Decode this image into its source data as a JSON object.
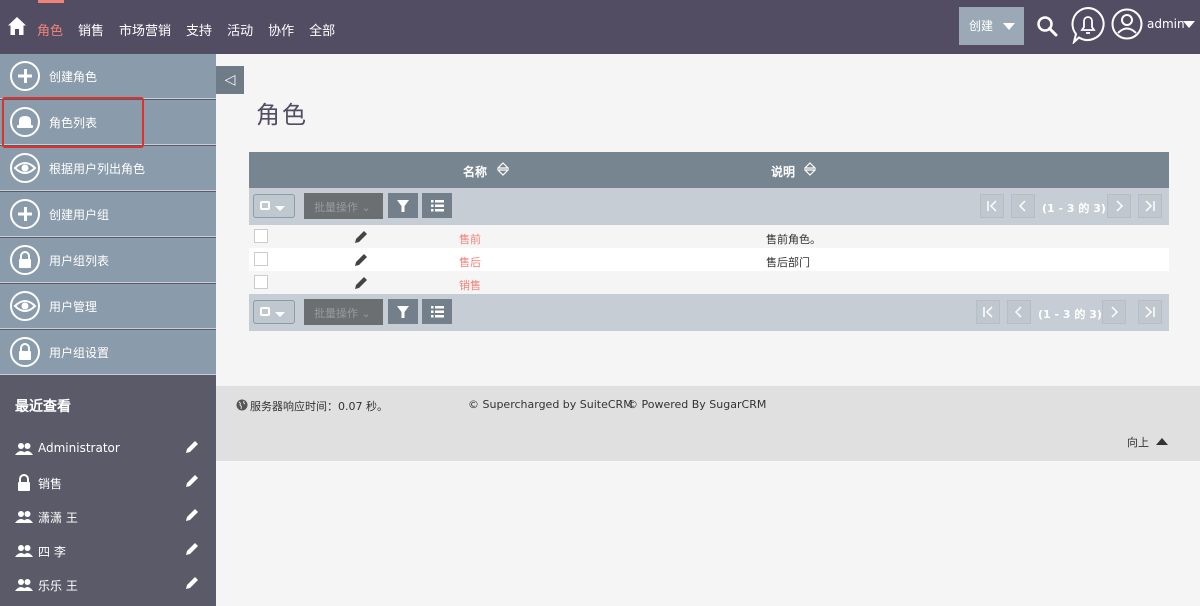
{
  "topnav": {
    "items": [
      "角色",
      "销售",
      "市场营销",
      "支持",
      "活动",
      "协作",
      "全部"
    ],
    "create_label": "创建",
    "user": "admin"
  },
  "sidebar": {
    "actions": [
      "创建角色",
      "角色列表",
      "根据用户列出角色",
      "创建用户组",
      "用户组列表",
      "用户管理",
      "用户组设置"
    ],
    "recent_title": "最近查看",
    "recent": [
      "Administrator",
      "销售",
      "潇潇 王",
      "四 李",
      "乐乐 王"
    ]
  },
  "main": {
    "title": "角色",
    "columns": [
      "名称",
      "说明"
    ],
    "bulk_label": "批量操作",
    "page_count": "(1 - 3 的 3)",
    "rows": [
      {
        "name": "售前",
        "desc": "售前角色。"
      },
      {
        "name": "售后",
        "desc": "售后部门"
      },
      {
        "name": "销售",
        "desc": ""
      }
    ]
  },
  "footer": {
    "response": "服务器响应时间：0.07 秒。",
    "credit1": "© Supercharged by SuiteCRM",
    "credit2": "© Powered By SugarCRM",
    "to_top": "向上"
  },
  "colors": {
    "nav_bg": "#534d64",
    "accent": "#f08377",
    "sidebar_action": "#8a9bab",
    "table_head": "#778591"
  }
}
